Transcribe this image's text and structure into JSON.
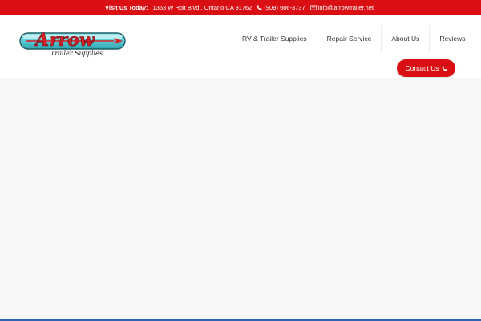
{
  "topbar": {
    "lead": "Visit Us Today:",
    "address": "1363 W Holt Blvd., Ontario CA 91762",
    "phone": "(909) 986-3737",
    "email": "info@arrowtrailer.net"
  },
  "logo": {
    "word": "Arrow",
    "tagline": "Trailer Supplies"
  },
  "nav": {
    "items": [
      {
        "label": "RV & Trailer Supplies"
      },
      {
        "label": "Repair Service"
      },
      {
        "label": "About Us"
      },
      {
        "label": "Reviews"
      }
    ]
  },
  "cta": {
    "label": "Contact Us"
  },
  "colors": {
    "brand_red": "#d90f13",
    "page_bg": "#f7f7f7",
    "accent_blue": "#2f66b3"
  },
  "icons": {
    "phone": "phone-icon",
    "email": "envelope-icon"
  }
}
